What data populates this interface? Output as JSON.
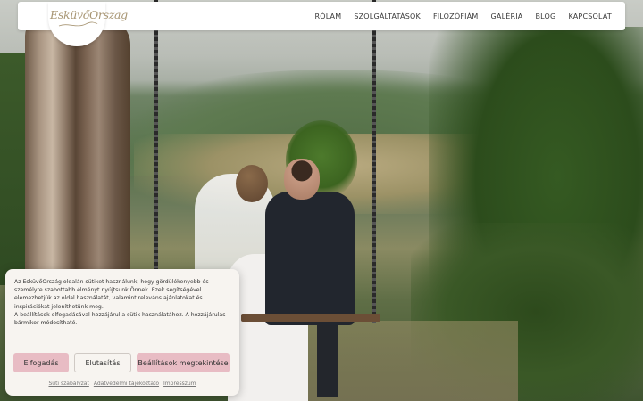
{
  "site": {
    "logo_text": "EsküvőOrszag"
  },
  "nav": {
    "items": [
      {
        "label": "RÓLAM"
      },
      {
        "label": "SZOLGÁLTATÁSOK"
      },
      {
        "label": "FILOZÓFIÁM"
      },
      {
        "label": "GALÉRIA"
      },
      {
        "label": "BLOG"
      },
      {
        "label": "KAPCSOLAT"
      }
    ]
  },
  "cookie_banner": {
    "text_line1": "Az EsküvőOrszág oldalán sütiket használunk, hogy gördülékenyebb és személyre szabottabb élményt nyújtsunk Önnek. Ezek segítségével elemezhetjük az oldal használatát, valamint releváns ajánlatokat és inspirációkat jeleníthetünk meg.",
    "text_line2": "A beállítások elfogadásával hozzájárul a sütik használatához. A hozzájárulás bármikor módosítható.",
    "accept_label": "Elfogadás",
    "deny_label": "Elutasítás",
    "settings_label": "Beállítások megtekintése",
    "links": [
      {
        "label": "Süti szabályzat"
      },
      {
        "label": "Adatvédelmi tájékoztató"
      },
      {
        "label": "Impresszum"
      }
    ]
  },
  "colors": {
    "accent_pink": "#e8bcc4",
    "logo_gold": "#a89674",
    "banner_bg": "#f7f4f0"
  }
}
